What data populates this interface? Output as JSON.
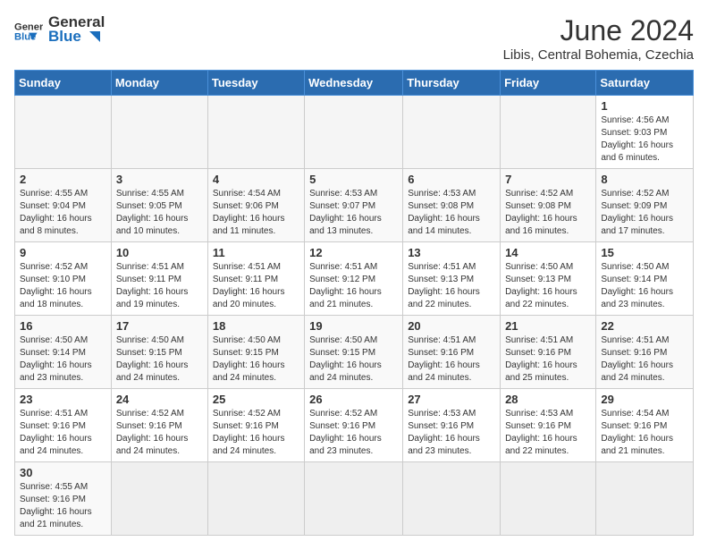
{
  "header": {
    "logo_general": "General",
    "logo_blue": "Blue",
    "title": "June 2024",
    "location": "Libis, Central Bohemia, Czechia"
  },
  "days_of_week": [
    "Sunday",
    "Monday",
    "Tuesday",
    "Wednesday",
    "Thursday",
    "Friday",
    "Saturday"
  ],
  "weeks": [
    {
      "days": [
        {
          "number": "",
          "info": "",
          "empty": true
        },
        {
          "number": "",
          "info": "",
          "empty": true
        },
        {
          "number": "",
          "info": "",
          "empty": true
        },
        {
          "number": "",
          "info": "",
          "empty": true
        },
        {
          "number": "",
          "info": "",
          "empty": true
        },
        {
          "number": "",
          "info": "",
          "empty": true
        },
        {
          "number": "1",
          "info": "Sunrise: 4:56 AM\nSunset: 9:03 PM\nDaylight: 16 hours and 6 minutes.",
          "empty": false
        }
      ]
    },
    {
      "days": [
        {
          "number": "2",
          "info": "Sunrise: 4:55 AM\nSunset: 9:04 PM\nDaylight: 16 hours and 8 minutes.",
          "empty": false
        },
        {
          "number": "3",
          "info": "Sunrise: 4:55 AM\nSunset: 9:05 PM\nDaylight: 16 hours and 10 minutes.",
          "empty": false
        },
        {
          "number": "4",
          "info": "Sunrise: 4:54 AM\nSunset: 9:06 PM\nDaylight: 16 hours and 11 minutes.",
          "empty": false
        },
        {
          "number": "5",
          "info": "Sunrise: 4:53 AM\nSunset: 9:07 PM\nDaylight: 16 hours and 13 minutes.",
          "empty": false
        },
        {
          "number": "6",
          "info": "Sunrise: 4:53 AM\nSunset: 9:08 PM\nDaylight: 16 hours and 14 minutes.",
          "empty": false
        },
        {
          "number": "7",
          "info": "Sunrise: 4:52 AM\nSunset: 9:08 PM\nDaylight: 16 hours and 16 minutes.",
          "empty": false
        },
        {
          "number": "8",
          "info": "Sunrise: 4:52 AM\nSunset: 9:09 PM\nDaylight: 16 hours and 17 minutes.",
          "empty": false
        }
      ]
    },
    {
      "days": [
        {
          "number": "9",
          "info": "Sunrise: 4:52 AM\nSunset: 9:10 PM\nDaylight: 16 hours and 18 minutes.",
          "empty": false
        },
        {
          "number": "10",
          "info": "Sunrise: 4:51 AM\nSunset: 9:11 PM\nDaylight: 16 hours and 19 minutes.",
          "empty": false
        },
        {
          "number": "11",
          "info": "Sunrise: 4:51 AM\nSunset: 9:11 PM\nDaylight: 16 hours and 20 minutes.",
          "empty": false
        },
        {
          "number": "12",
          "info": "Sunrise: 4:51 AM\nSunset: 9:12 PM\nDaylight: 16 hours and 21 minutes.",
          "empty": false
        },
        {
          "number": "13",
          "info": "Sunrise: 4:51 AM\nSunset: 9:13 PM\nDaylight: 16 hours and 22 minutes.",
          "empty": false
        },
        {
          "number": "14",
          "info": "Sunrise: 4:50 AM\nSunset: 9:13 PM\nDaylight: 16 hours and 22 minutes.",
          "empty": false
        },
        {
          "number": "15",
          "info": "Sunrise: 4:50 AM\nSunset: 9:14 PM\nDaylight: 16 hours and 23 minutes.",
          "empty": false
        }
      ]
    },
    {
      "days": [
        {
          "number": "16",
          "info": "Sunrise: 4:50 AM\nSunset: 9:14 PM\nDaylight: 16 hours and 23 minutes.",
          "empty": false
        },
        {
          "number": "17",
          "info": "Sunrise: 4:50 AM\nSunset: 9:15 PM\nDaylight: 16 hours and 24 minutes.",
          "empty": false
        },
        {
          "number": "18",
          "info": "Sunrise: 4:50 AM\nSunset: 9:15 PM\nDaylight: 16 hours and 24 minutes.",
          "empty": false
        },
        {
          "number": "19",
          "info": "Sunrise: 4:50 AM\nSunset: 9:15 PM\nDaylight: 16 hours and 24 minutes.",
          "empty": false
        },
        {
          "number": "20",
          "info": "Sunrise: 4:51 AM\nSunset: 9:16 PM\nDaylight: 16 hours and 24 minutes.",
          "empty": false
        },
        {
          "number": "21",
          "info": "Sunrise: 4:51 AM\nSunset: 9:16 PM\nDaylight: 16 hours and 25 minutes.",
          "empty": false
        },
        {
          "number": "22",
          "info": "Sunrise: 4:51 AM\nSunset: 9:16 PM\nDaylight: 16 hours and 24 minutes.",
          "empty": false
        }
      ]
    },
    {
      "days": [
        {
          "number": "23",
          "info": "Sunrise: 4:51 AM\nSunset: 9:16 PM\nDaylight: 16 hours and 24 minutes.",
          "empty": false
        },
        {
          "number": "24",
          "info": "Sunrise: 4:52 AM\nSunset: 9:16 PM\nDaylight: 16 hours and 24 minutes.",
          "empty": false
        },
        {
          "number": "25",
          "info": "Sunrise: 4:52 AM\nSunset: 9:16 PM\nDaylight: 16 hours and 24 minutes.",
          "empty": false
        },
        {
          "number": "26",
          "info": "Sunrise: 4:52 AM\nSunset: 9:16 PM\nDaylight: 16 hours and 23 minutes.",
          "empty": false
        },
        {
          "number": "27",
          "info": "Sunrise: 4:53 AM\nSunset: 9:16 PM\nDaylight: 16 hours and 23 minutes.",
          "empty": false
        },
        {
          "number": "28",
          "info": "Sunrise: 4:53 AM\nSunset: 9:16 PM\nDaylight: 16 hours and 22 minutes.",
          "empty": false
        },
        {
          "number": "29",
          "info": "Sunrise: 4:54 AM\nSunset: 9:16 PM\nDaylight: 16 hours and 21 minutes.",
          "empty": false
        }
      ]
    },
    {
      "days": [
        {
          "number": "30",
          "info": "Sunrise: 4:55 AM\nSunset: 9:16 PM\nDaylight: 16 hours and 21 minutes.",
          "empty": false
        },
        {
          "number": "",
          "info": "",
          "empty": true
        },
        {
          "number": "",
          "info": "",
          "empty": true
        },
        {
          "number": "",
          "info": "",
          "empty": true
        },
        {
          "number": "",
          "info": "",
          "empty": true
        },
        {
          "number": "",
          "info": "",
          "empty": true
        },
        {
          "number": "",
          "info": "",
          "empty": true
        }
      ]
    }
  ]
}
